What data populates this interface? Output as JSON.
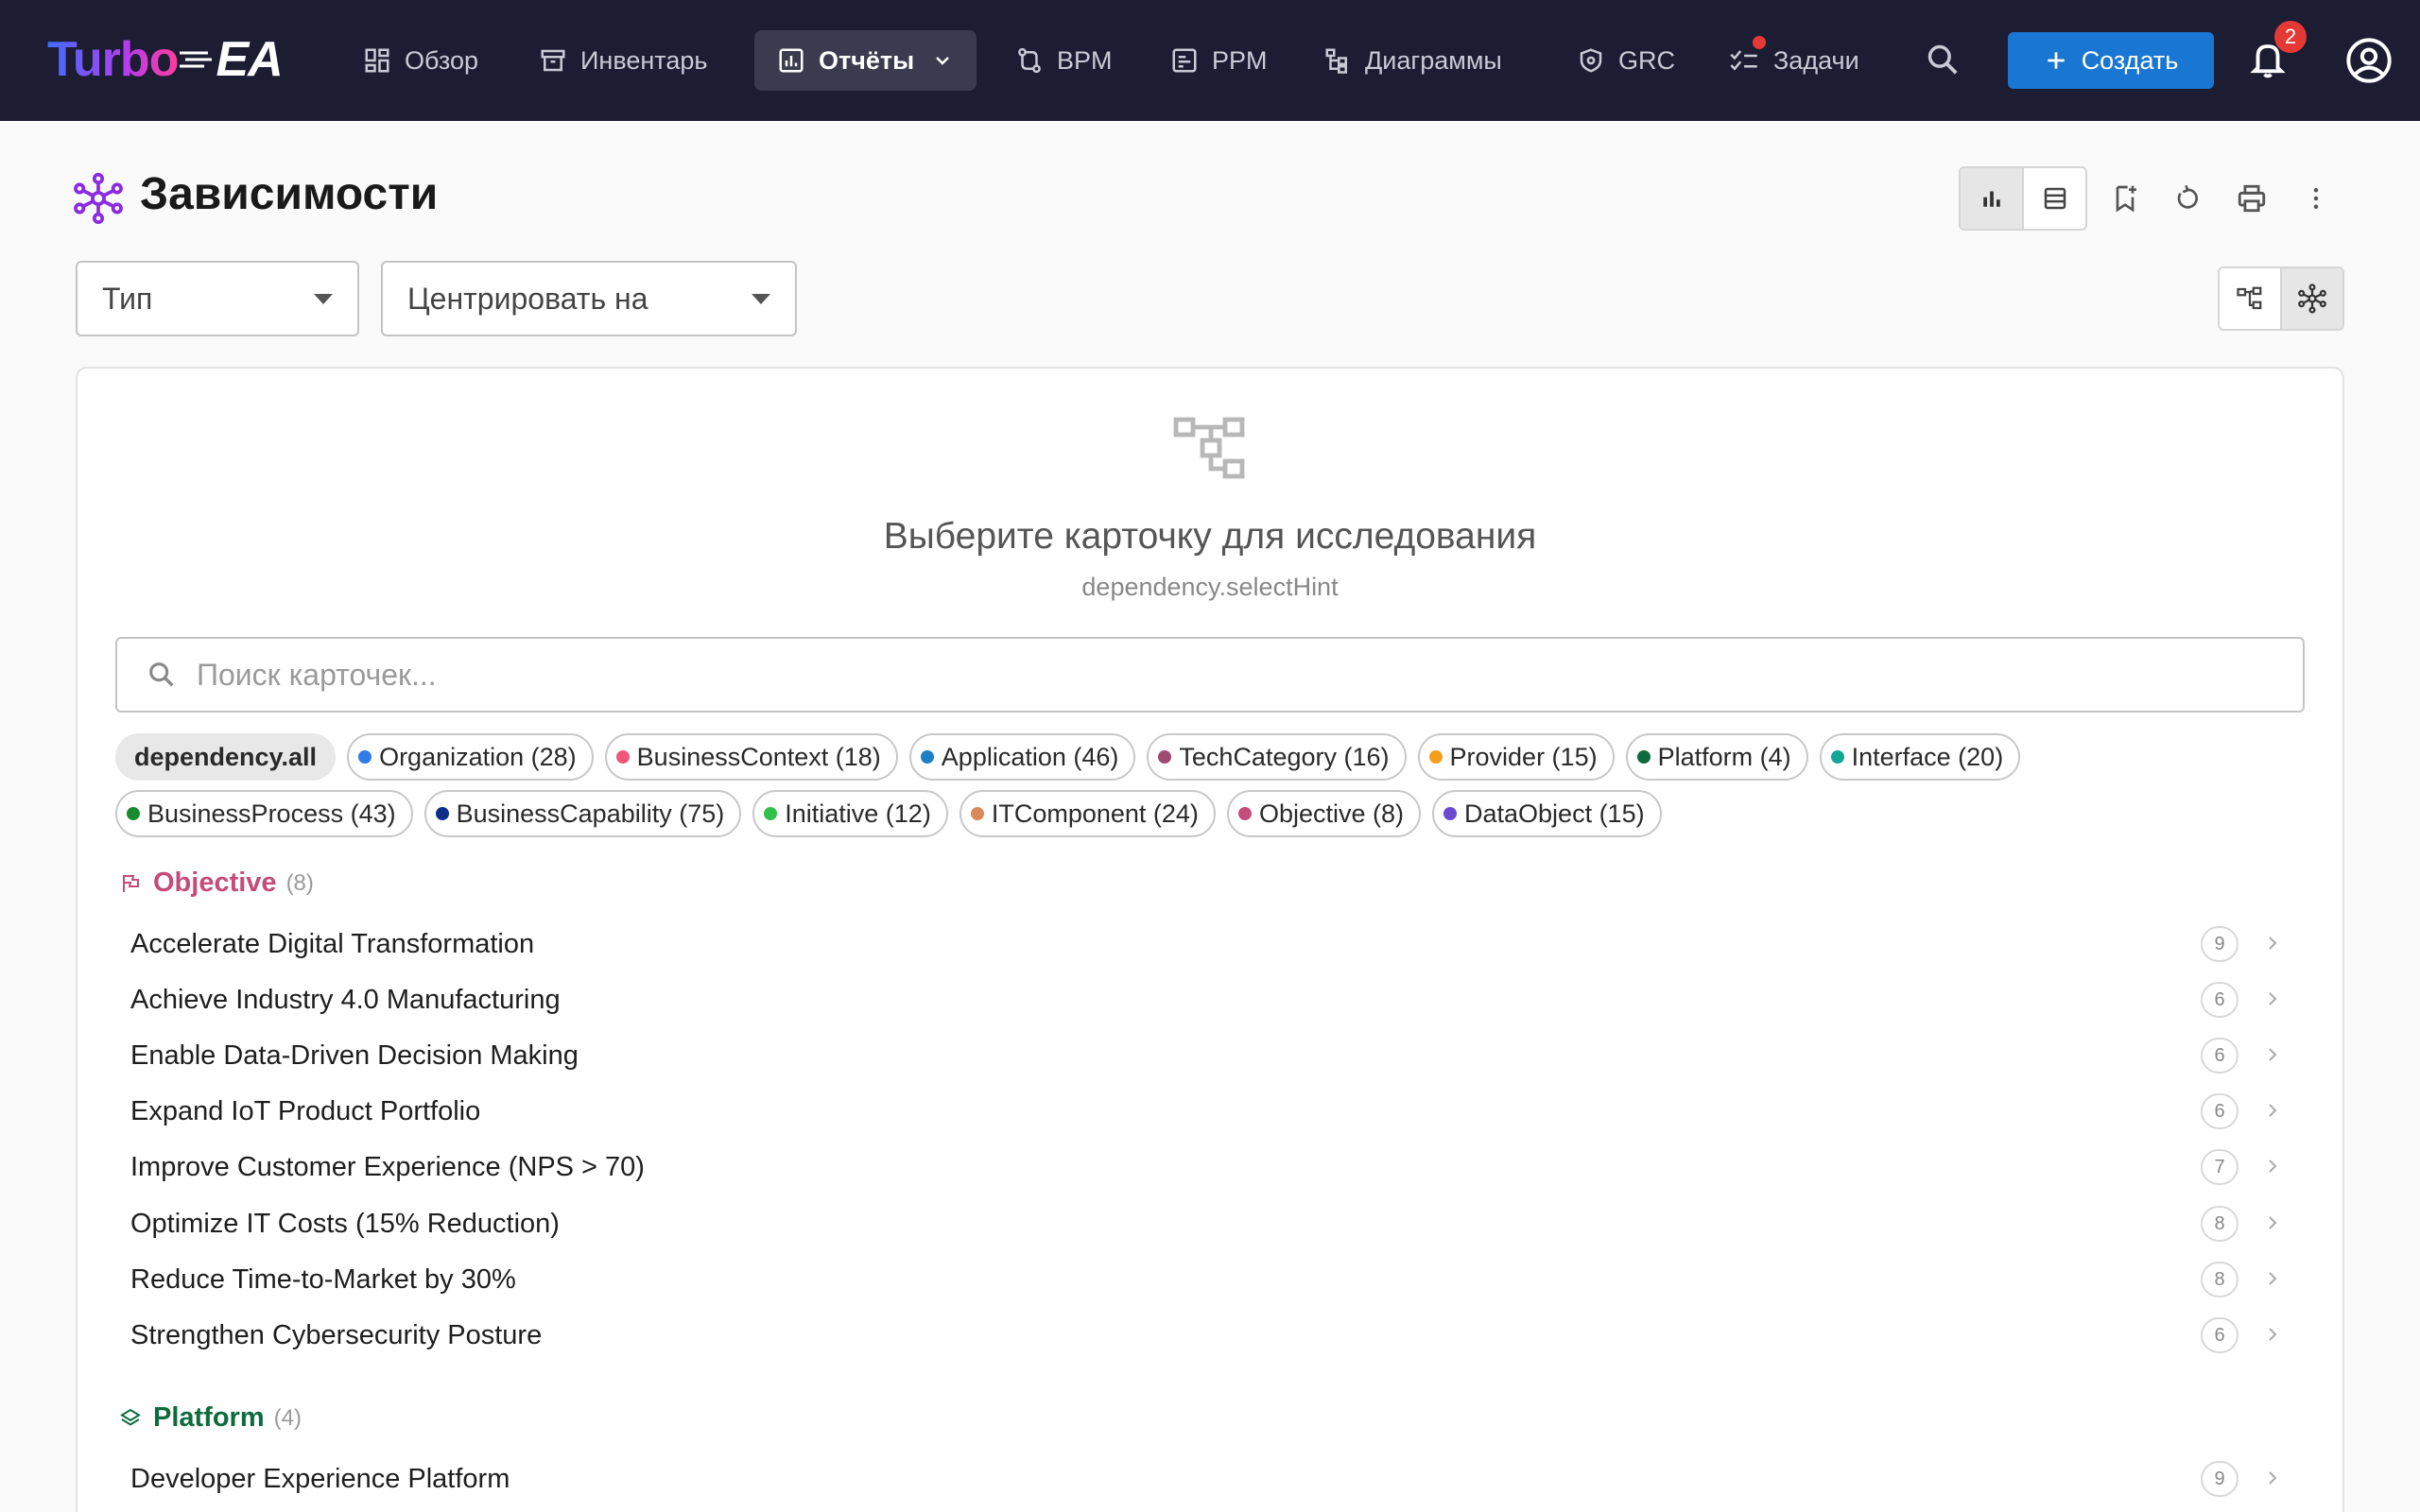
{
  "logo": {
    "turbo": "Turbo",
    "ea": "EA"
  },
  "nav": {
    "items": [
      {
        "label": "Обзор"
      },
      {
        "label": "Инвентарь"
      },
      {
        "label": "Отчёты"
      },
      {
        "label": "BPM"
      },
      {
        "label": "PPM"
      },
      {
        "label": "Диаграммы"
      },
      {
        "label": "GRC"
      },
      {
        "label": "Задачи"
      }
    ],
    "create_label": "Создать",
    "notifications_count": "2"
  },
  "page": {
    "title": "Зависимости",
    "type_select": "Тип",
    "center_select": "Центрировать на"
  },
  "empty_state": {
    "title": "Выберите карточку для исследования",
    "hint": "dependency.selectHint"
  },
  "search": {
    "placeholder": "Поиск карточек..."
  },
  "filters": {
    "all_label": "dependency.all",
    "chips": [
      {
        "label": "Organization (28)",
        "color": "#2f7be8"
      },
      {
        "label": "BusinessContext (18)",
        "color": "#f0567a"
      },
      {
        "label": "Application (46)",
        "color": "#1e7fc2"
      },
      {
        "label": "TechCategory (16)",
        "color": "#a04a72"
      },
      {
        "label": "Provider (15)",
        "color": "#f59e1b"
      },
      {
        "label": "Platform (4)",
        "color": "#0f6b3d"
      },
      {
        "label": "Interface (20)",
        "color": "#12a898"
      },
      {
        "label": "BusinessProcess (43)",
        "color": "#1a8a2e"
      },
      {
        "label": "BusinessCapability (75)",
        "color": "#0d2f8a"
      },
      {
        "label": "Initiative (12)",
        "color": "#33c04a"
      },
      {
        "label": "ITComponent (24)",
        "color": "#d98a5a"
      },
      {
        "label": "Objective (8)",
        "color": "#c44b7a"
      },
      {
        "label": "DataObject (15)",
        "color": "#6a4bd0"
      }
    ]
  },
  "groups": [
    {
      "name": "Objective",
      "count": "(8)",
      "color": "#c44b7a",
      "items": [
        {
          "name": "Accelerate Digital Transformation",
          "count": "9"
        },
        {
          "name": "Achieve Industry 4.0 Manufacturing",
          "count": "6"
        },
        {
          "name": "Enable Data-Driven Decision Making",
          "count": "6"
        },
        {
          "name": "Expand IoT Product Portfolio",
          "count": "6"
        },
        {
          "name": "Improve Customer Experience (NPS > 70)",
          "count": "7"
        },
        {
          "name": "Optimize IT Costs (15% Reduction)",
          "count": "8"
        },
        {
          "name": "Reduce Time-to-Market by 30%",
          "count": "8"
        },
        {
          "name": "Strengthen Cybersecurity Posture",
          "count": "6"
        }
      ]
    },
    {
      "name": "Platform",
      "count": "(4)",
      "color": "#0f6b3d",
      "items": [
        {
          "name": "Developer Experience Platform",
          "count": "9"
        }
      ]
    }
  ]
}
